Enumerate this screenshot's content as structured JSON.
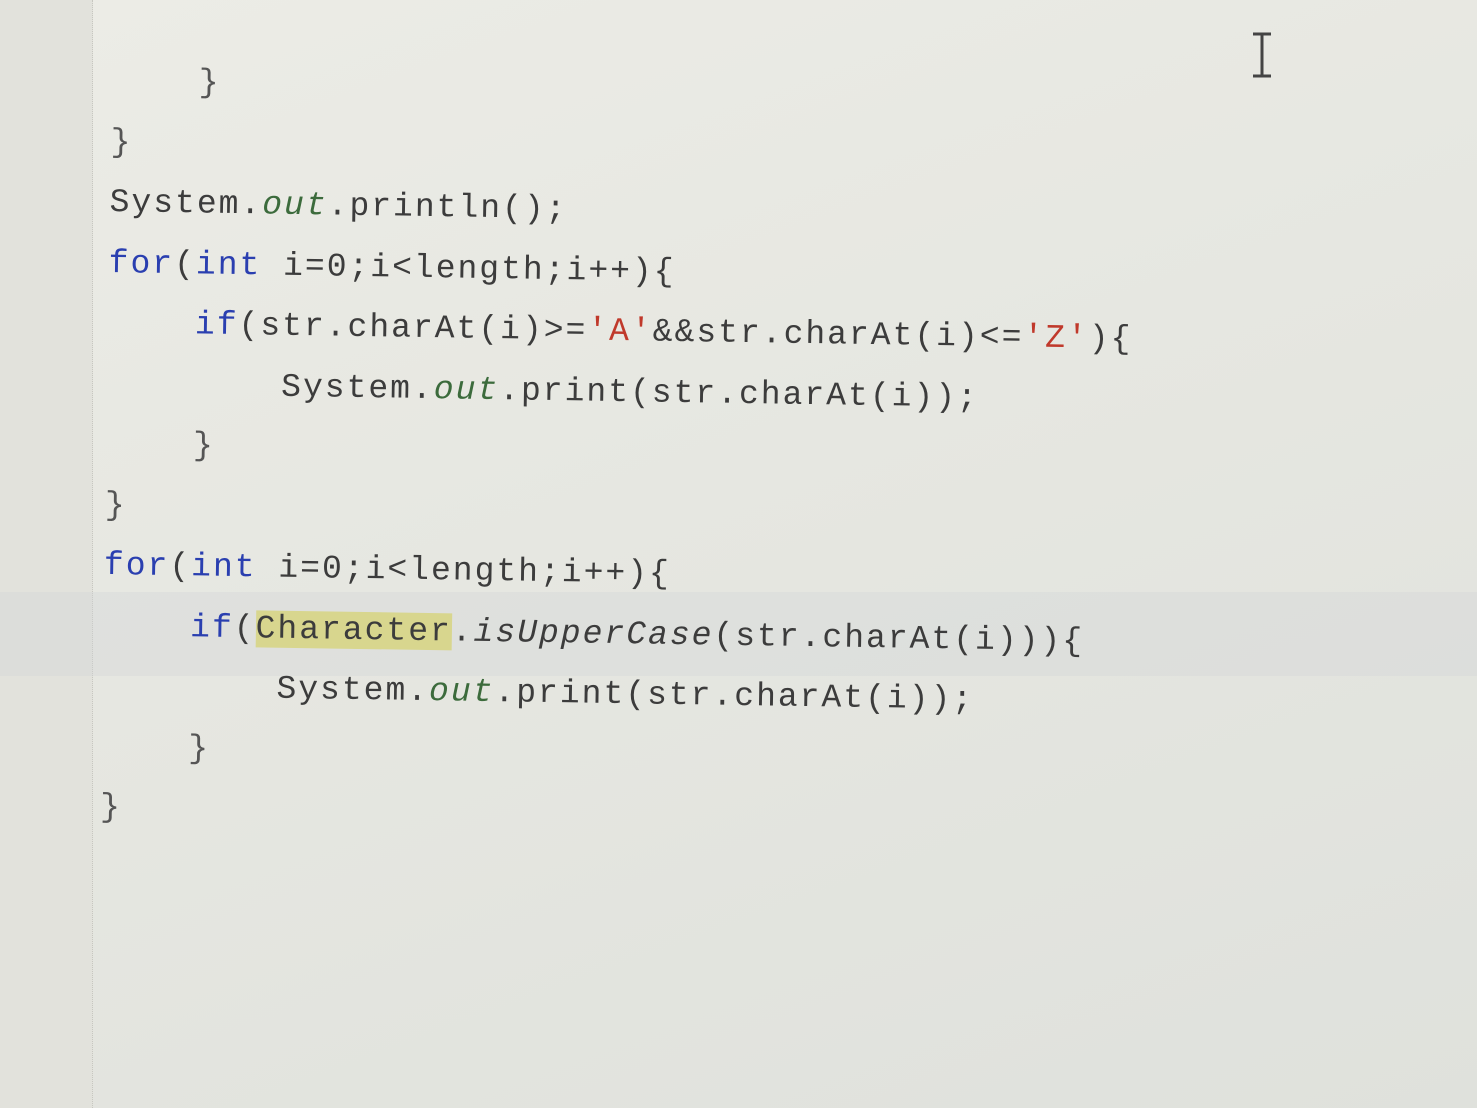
{
  "editor": {
    "lines": [
      {
        "indent": "    ",
        "tokens": [
          {
            "t": "}",
            "k": "brace"
          }
        ]
      },
      {
        "indent": "",
        "tokens": [
          {
            "t": "}",
            "k": "brace"
          }
        ]
      },
      {
        "indent": "",
        "tokens": [
          {
            "t": "System.",
            "k": "plain"
          },
          {
            "t": "out",
            "k": "field"
          },
          {
            "t": ".println();",
            "k": "plain"
          }
        ]
      },
      {
        "indent": "",
        "tokens": [
          {
            "t": "for",
            "k": "kw"
          },
          {
            "t": "(",
            "k": "plain"
          },
          {
            "t": "int",
            "k": "kw"
          },
          {
            "t": " i=0;i<length;i++){",
            "k": "plain"
          }
        ]
      },
      {
        "indent": "    ",
        "tokens": [
          {
            "t": "if",
            "k": "kw"
          },
          {
            "t": "(str.charAt(i)>=",
            "k": "plain"
          },
          {
            "t": "'A'",
            "k": "str"
          },
          {
            "t": "&&str.charAt(i)<=",
            "k": "plain"
          },
          {
            "t": "'Z'",
            "k": "str"
          },
          {
            "t": "){",
            "k": "plain"
          }
        ]
      },
      {
        "indent": "        ",
        "tokens": [
          {
            "t": "System.",
            "k": "plain"
          },
          {
            "t": "out",
            "k": "field"
          },
          {
            "t": ".print(str.charAt(i));",
            "k": "plain"
          }
        ]
      },
      {
        "indent": "    ",
        "tokens": [
          {
            "t": "}",
            "k": "brace"
          }
        ]
      },
      {
        "indent": "",
        "tokens": [
          {
            "t": "}",
            "k": "brace"
          }
        ]
      },
      {
        "indent": "",
        "tokens": [
          {
            "t": "for",
            "k": "kw"
          },
          {
            "t": "(",
            "k": "plain"
          },
          {
            "t": "int",
            "k": "kw"
          },
          {
            "t": " i=0;i<length;i++){",
            "k": "plain"
          }
        ]
      },
      {
        "indent": "    ",
        "tokens": [
          {
            "t": "if",
            "k": "kw"
          },
          {
            "t": "(",
            "k": "plain"
          },
          {
            "t": "Character",
            "k": "hl"
          },
          {
            "t": ".",
            "k": "plain"
          },
          {
            "t": "isUpperCase",
            "k": "method-static"
          },
          {
            "t": "(str.charAt(i))){",
            "k": "plain"
          }
        ]
      },
      {
        "indent": "        ",
        "tokens": [
          {
            "t": "System.",
            "k": "plain"
          },
          {
            "t": "out",
            "k": "field"
          },
          {
            "t": ".print(str.charAt(i));",
            "k": "plain"
          }
        ]
      },
      {
        "indent": "    ",
        "tokens": [
          {
            "t": "}",
            "k": "brace"
          }
        ]
      },
      {
        "indent": "",
        "tokens": [
          {
            "t": "}",
            "k": "brace"
          }
        ]
      }
    ]
  },
  "icons": {
    "cursor": "text-cursor-icon"
  },
  "colors": {
    "keyword": "#2a3fb0",
    "field": "#3c6b3c",
    "string": "#c0392b",
    "highlight": "#d8d68e",
    "text": "#3c3c3c",
    "background": "#e9e9e3"
  }
}
